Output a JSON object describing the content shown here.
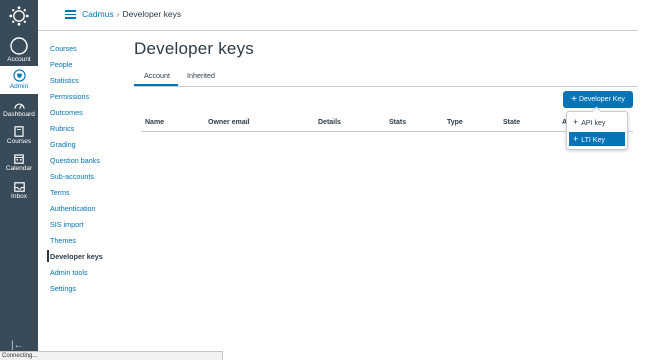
{
  "global_nav": {
    "items": [
      {
        "label": "Account",
        "icon": "account-icon"
      },
      {
        "label": "Admin",
        "icon": "admin-shield-icon"
      },
      {
        "label": "Dashboard",
        "icon": "dashboard-icon"
      },
      {
        "label": "Courses",
        "icon": "courses-book-icon"
      },
      {
        "label": "Calendar",
        "icon": "calendar-icon"
      },
      {
        "label": "Inbox",
        "icon": "inbox-icon"
      }
    ],
    "active": "Admin",
    "bg_color": "#394b58",
    "accent_color": "#0374b5"
  },
  "breadcrumb": {
    "root": "Cadmus",
    "separator": "›",
    "current": "Developer keys"
  },
  "admin_nav": {
    "items": [
      "Courses",
      "People",
      "Statistics",
      "Permissions",
      "Outcomes",
      "Rubrics",
      "Grading",
      "Question banks",
      "Sub-accounts",
      "Terms",
      "Authentication",
      "SIS import",
      "Themes",
      "Developer keys",
      "Admin tools",
      "Settings"
    ],
    "active": "Developer keys"
  },
  "page": {
    "title": "Developer keys",
    "tabs": [
      "Account",
      "Inherited"
    ],
    "active_tab": "Account",
    "add_button_label": "Developer Key"
  },
  "table": {
    "columns": [
      "Name",
      "Owner email",
      "Details",
      "Stats",
      "Type",
      "State",
      "A"
    ]
  },
  "menu": {
    "items": [
      "API key",
      "LTI Key"
    ],
    "highlighted": "LTI Key"
  },
  "status_bar": {
    "text": "Connecting..."
  }
}
